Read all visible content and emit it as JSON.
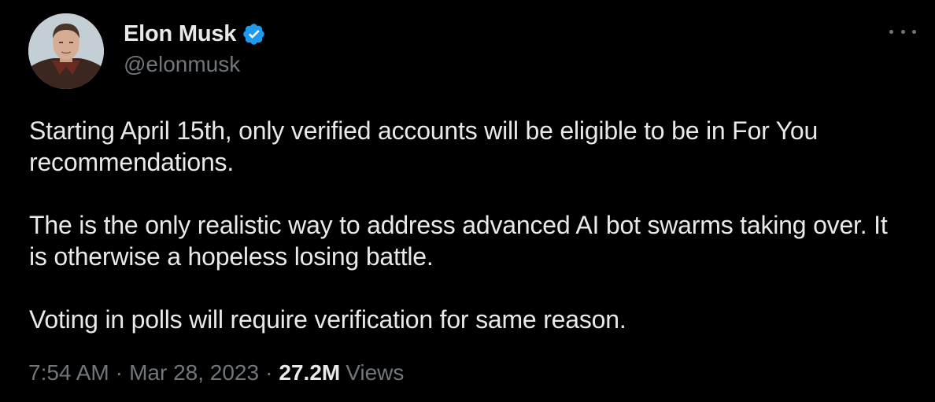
{
  "author": {
    "name": "Elon Musk",
    "handle": "@elonmusk",
    "verified": true
  },
  "tweet": {
    "paragraphs": [
      "Starting April 15th, only verified accounts will be eligible to be in For You recommendations.",
      "The is the only realistic way to address advanced AI bot swarms taking over. It is otherwise a hopeless losing battle.",
      "Voting in polls will require verification for same reason."
    ]
  },
  "meta": {
    "time": "7:54 AM",
    "separator": "·",
    "date": "Mar 28, 2023",
    "views_count": "27.2M",
    "views_label": "Views"
  },
  "icons": {
    "verified": "verified-badge-icon",
    "more": "more-options-icon"
  },
  "colors": {
    "background": "#000000",
    "text_primary": "#e7e9ea",
    "text_secondary": "#71767b",
    "verified_blue": "#1d9bf0"
  }
}
